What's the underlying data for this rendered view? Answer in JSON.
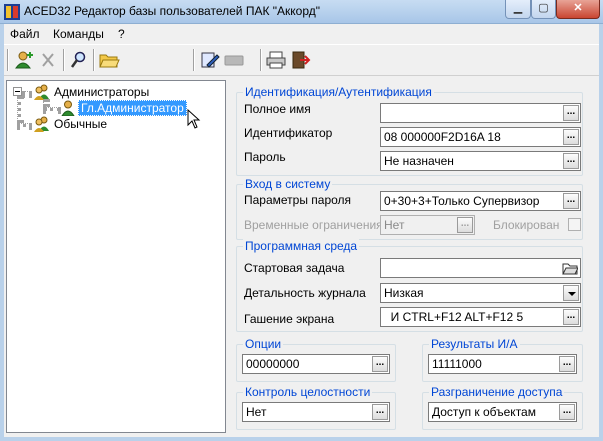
{
  "window": {
    "title": "ACED32 Редактор базы пользователей ПАК \"Аккорд\""
  },
  "menu": {
    "items": [
      {
        "label": "Файл"
      },
      {
        "label": "Команды"
      },
      {
        "label": "?"
      }
    ]
  },
  "tree": {
    "nodes": [
      {
        "label": "Администраторы"
      },
      {
        "label": "Гл.Администратор"
      },
      {
        "label": "Обычные"
      }
    ]
  },
  "ident": {
    "title": "Идентификация/Аутентификация",
    "fullname_label": "Полное имя",
    "fullname_value": "",
    "id_label": "Идентификатор",
    "id_value": "08 000000F2D16A 18",
    "password_label": "Пароль",
    "password_value": "Не назначен"
  },
  "login": {
    "title": "Вход в систему",
    "params_label": "Параметры пароля",
    "params_value": "0+30+3+Только Супервизор",
    "time_label": "Временные ограничения",
    "time_value": "Нет",
    "blocked_label": "Блокирован"
  },
  "env": {
    "title": "Программная среда",
    "start_label": "Стартовая задача",
    "start_value": "",
    "log_label": "Детальность журнала",
    "log_value": "Низкая",
    "screen_label": "Гашение экрана",
    "screen_value": "  И CTRL+F12 ALT+F12 5"
  },
  "options": {
    "title": "Опции",
    "value": "00000000"
  },
  "results": {
    "title": "Результаты И/А",
    "value": "11111000"
  },
  "integrity": {
    "title": "Контроль целостности",
    "value": "Нет"
  },
  "access": {
    "title": "Разграничение доступа",
    "value": "Доступ к объектам"
  },
  "dots_label": "...",
  "colors": {
    "group_title": "#0046d5",
    "selection": "#3399ff"
  }
}
